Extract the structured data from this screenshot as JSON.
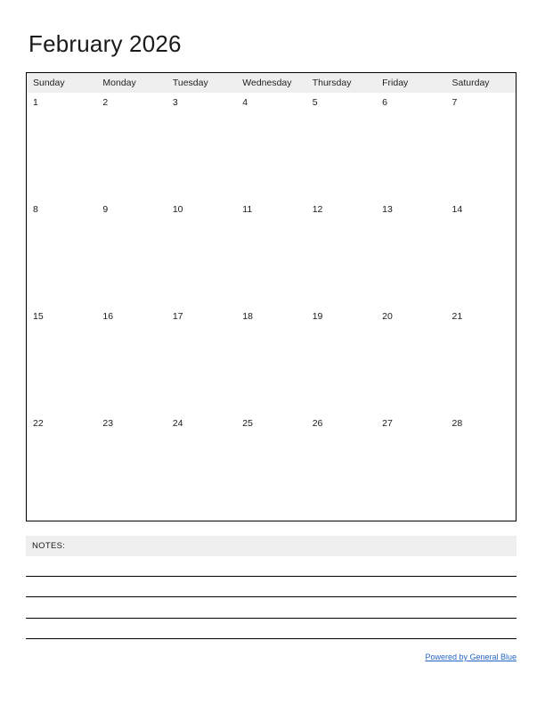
{
  "document": {
    "title": "February 2026",
    "month": "February",
    "year": "2026"
  },
  "calendar": {
    "weekday_headers": [
      "Sunday",
      "Monday",
      "Tuesday",
      "Wednesday",
      "Thursday",
      "Friday",
      "Saturday"
    ],
    "weeks": [
      {
        "days": [
          "1",
          "2",
          "3",
          "4",
          "5",
          "6",
          "7"
        ]
      },
      {
        "days": [
          "8",
          "9",
          "10",
          "11",
          "12",
          "13",
          "14"
        ]
      },
      {
        "days": [
          "15",
          "16",
          "17",
          "18",
          "19",
          "20",
          "21"
        ]
      },
      {
        "days": [
          "22",
          "23",
          "24",
          "25",
          "26",
          "27",
          "28"
        ]
      }
    ]
  },
  "notes": {
    "label": "NOTES:",
    "line_count": "4"
  },
  "footer": {
    "link_text": "Powered by General Blue"
  },
  "colors": {
    "header_background": "#efefef",
    "grid_border": "#000000",
    "text": "#1a1a1a",
    "link": "#2566c8",
    "page_background": "#ffffff"
  }
}
